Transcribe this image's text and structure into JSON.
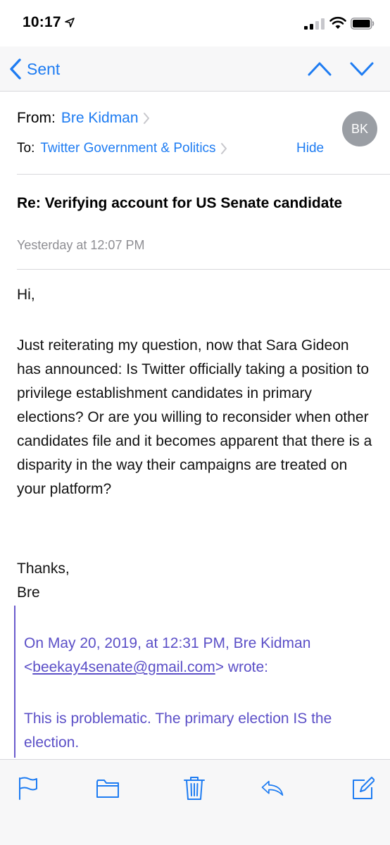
{
  "status": {
    "time": "10:17"
  },
  "nav": {
    "back_label": "Sent"
  },
  "header": {
    "from_label": "From:",
    "from_name": "Bre Kidman",
    "to_label": "To:",
    "to_name": "Twitter Government & Politics",
    "hide_label": "Hide",
    "avatar_initials": "BK"
  },
  "message": {
    "subject": "Re: Verifying account for US Senate candidate",
    "date": "Yesterday at 12:07 PM",
    "greeting": "Hi,",
    "paragraph": "Just reiterating my question, now that Sara Gideon has announced: Is Twitter officially taking a position to privilege establishment candidates in primary elections? Or are you willing to reconsider when other candidates file and it becomes apparent that there is a disparity in the way their campaigns are treated on your platform?",
    "thanks": "Thanks,",
    "signature": "Bre"
  },
  "quote": {
    "line1": "On May 20, 2019, at 12:31 PM, Bre Kidman",
    "email_open": "<",
    "email": "beekay4senate@gmail.com",
    "email_close": "> wrote:",
    "text": "This is problematic. The primary election IS the election."
  },
  "toolbar": {
    "icons": [
      "flag-icon",
      "folder-icon",
      "trash-icon",
      "reply-icon",
      "compose-icon"
    ]
  },
  "colors": {
    "accent": "#1e7cf2",
    "quote": "#5b4fc7",
    "avatar": "#9a9ea4"
  }
}
